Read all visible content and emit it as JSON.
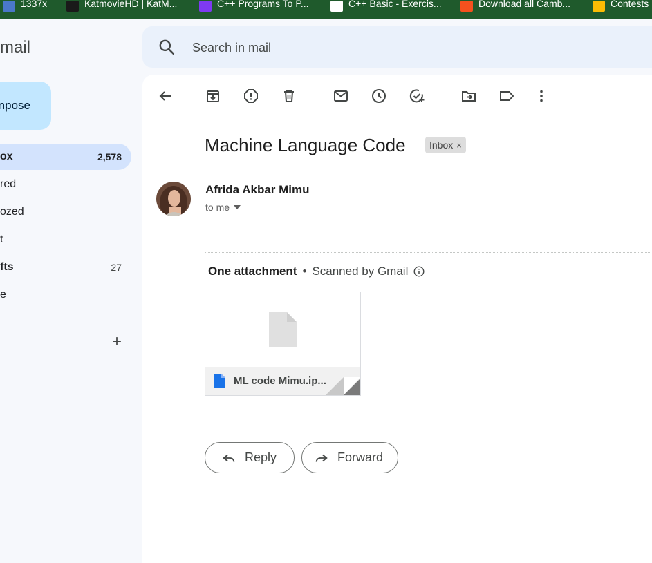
{
  "bookmarks": [
    {
      "label": "1337x",
      "icon": "tv-icon",
      "color": "#4a78c9"
    },
    {
      "label": "KatmovieHD | KatM...",
      "icon": "k-logo-icon",
      "color": "#1a1a1a"
    },
    {
      "label": "C++ Programs To P...",
      "icon": "c-logo-icon",
      "color": "#7e3af2"
    },
    {
      "label": "C++ Basic - Exercis...",
      "icon": "w3r-icon",
      "color": "#ffffff"
    },
    {
      "label": "Download all Camb...",
      "icon": "blogger-icon",
      "color": "#f4511e"
    },
    {
      "label": "Contests",
      "icon": "bars-icon",
      "color": "#fbbc04"
    }
  ],
  "sidebar": {
    "app_name": "mail",
    "compose_label": "npose",
    "items": [
      {
        "label": "ox",
        "count": "2,578"
      },
      {
        "label": "red",
        "count": ""
      },
      {
        "label": "ozed",
        "count": ""
      },
      {
        "label": "t",
        "count": ""
      },
      {
        "label": "fts",
        "count": "27"
      },
      {
        "label": "e",
        "count": ""
      }
    ]
  },
  "search": {
    "placeholder": "Search in mail"
  },
  "email": {
    "subject": "Machine Language Code",
    "label_chip": "Inbox",
    "label_close": "×",
    "sender": "Afrida Akbar Mimu",
    "recipient": "to me",
    "attachments_title": "One attachment",
    "bullet": "•",
    "scan_note": "Scanned by Gmail",
    "attachment_name": "ML code Mimu.ip..."
  },
  "actions": {
    "reply": "Reply",
    "forward": "Forward"
  },
  "colors": {
    "accent": "#0b57d0",
    "compose_bg": "#c2e7ff",
    "active_nav": "#d3e3fd",
    "bookmark_bar": "#1f5a2c"
  }
}
